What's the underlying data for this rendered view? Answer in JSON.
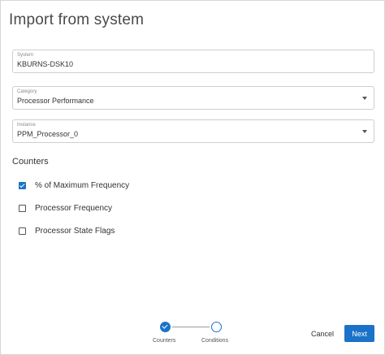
{
  "dialog": {
    "title": "Import from system"
  },
  "fields": {
    "system": {
      "label": "System",
      "value": "KBURNS-DSK10"
    },
    "category": {
      "label": "Category",
      "value": "Processor Performance"
    },
    "instance": {
      "label": "Instance",
      "value": "PPM_Processor_0"
    }
  },
  "counters": {
    "title": "Counters",
    "items": [
      {
        "label": "% of Maximum Frequency",
        "checked": true
      },
      {
        "label": "Processor Frequency",
        "checked": false
      },
      {
        "label": "Processor State Flags",
        "checked": false
      }
    ]
  },
  "stepper": {
    "steps": [
      {
        "label": "Counters",
        "state": "completed"
      },
      {
        "label": "Conditions",
        "state": "current"
      }
    ]
  },
  "footer": {
    "cancel_label": "Cancel",
    "next_label": "Next"
  },
  "colors": {
    "accent": "#1a73c8",
    "border": "#cfcfcf",
    "text": "#333333"
  }
}
